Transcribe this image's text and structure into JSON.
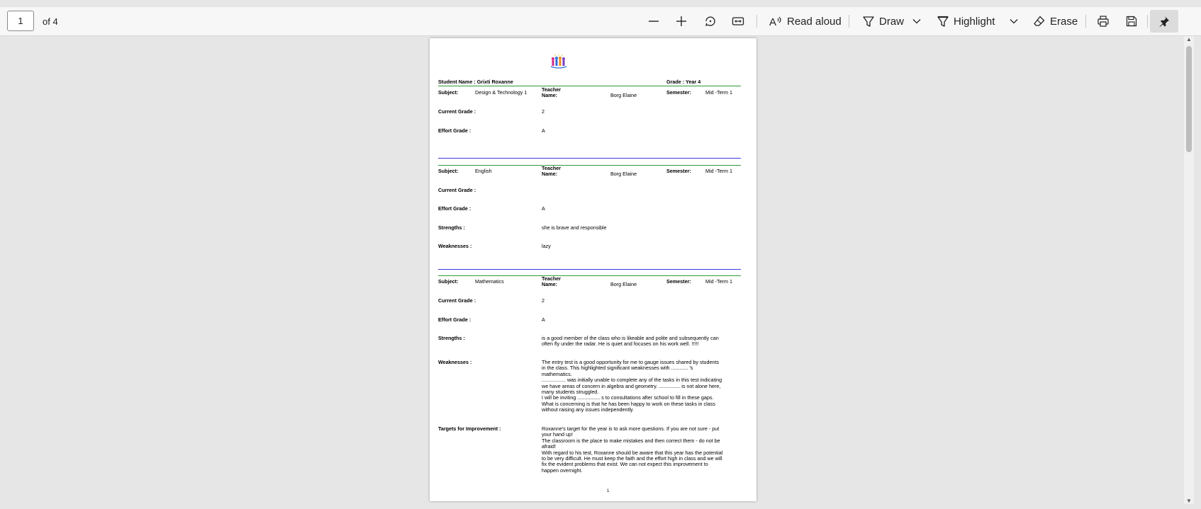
{
  "toolbar": {
    "page_current": "1",
    "page_total_label": "of 4",
    "read_aloud_label": "Read aloud",
    "draw_label": "Draw",
    "highlight_label": "Highlight",
    "erase_label": "Erase"
  },
  "document": {
    "student_label": "Student Name : Grixti Roxanne",
    "grade_label": "Grade : Year 4",
    "labels": {
      "subject": "Subject:",
      "teacher": "Teacher\nName:",
      "semester": "Semester:",
      "current_grade": "Current Grade :",
      "effort_grade": "Effort Grade :",
      "strengths": "Strengths :",
      "weaknesses": "Weaknesses :",
      "targets": "Targets for Improvement :"
    },
    "sections": [
      {
        "subject": "Design & Technology  1",
        "teacher": "Borg Elaine",
        "semester": "Mid -Term 1",
        "current_grade": "2",
        "effort_grade": "A"
      },
      {
        "subject": "English",
        "teacher": "Borg Elaine",
        "semester": "Mid -Term 1",
        "current_grade": "",
        "effort_grade": "A",
        "strengths": "she is brave and responsible",
        "weaknesses": "lazy"
      },
      {
        "subject": "Mathematics",
        "teacher": "Borg Elaine",
        "semester": "Mid -Term 1",
        "current_grade": "2",
        "effort_grade": "A",
        "strengths": "is a good member of the class who is likeable and polite and subsequently can\noften fly under the radar. He is quiet and focuses on his work well. !!!!!",
        "weaknesses": "The entry test is a good opportunity for me to gauge issues shared by students\nin the class. This highlighted significant weaknesses with ............ 's\nmathematics.\n................. was initially unable to complete any of the tasks in this test indicating\nwe have areas of concern in algebra and geometry. ............... is not alone here,\nmany students struggled.\nI will be inviting ................ s to consultations after school to fill in these gaps.\nWhat is concerning is that he has been happy to work on these tasks in class\nwithout raising any issues independently.",
        "targets": "Roxanne's target for the year is to ask more questions. If you are not sure - put\nyour hand up!\nThe classroom is the place to make mistakes and then correct them - do not be\nafraid!\nWith regard to his test, Roxanne should be aware that this year has the potential\nto be very difficult. He must keep the faith and the effort high in class and we will\nfix the evident problems that exist. We can not expect this improvement to\nhappen overnight."
      }
    ],
    "page_number": "1"
  },
  "colors": {
    "section_rule_top": "#2e9a3a",
    "section_rule_bottom": "#3a3ae0"
  },
  "icons": [
    "zoom-out-icon",
    "zoom-in-icon",
    "rotate-icon",
    "fit-width-icon",
    "read-aloud-icon",
    "draw-icon",
    "chevron-down-icon",
    "highlight-icon",
    "erase-icon",
    "print-icon",
    "save-icon",
    "pin-icon",
    "school-logo"
  ]
}
